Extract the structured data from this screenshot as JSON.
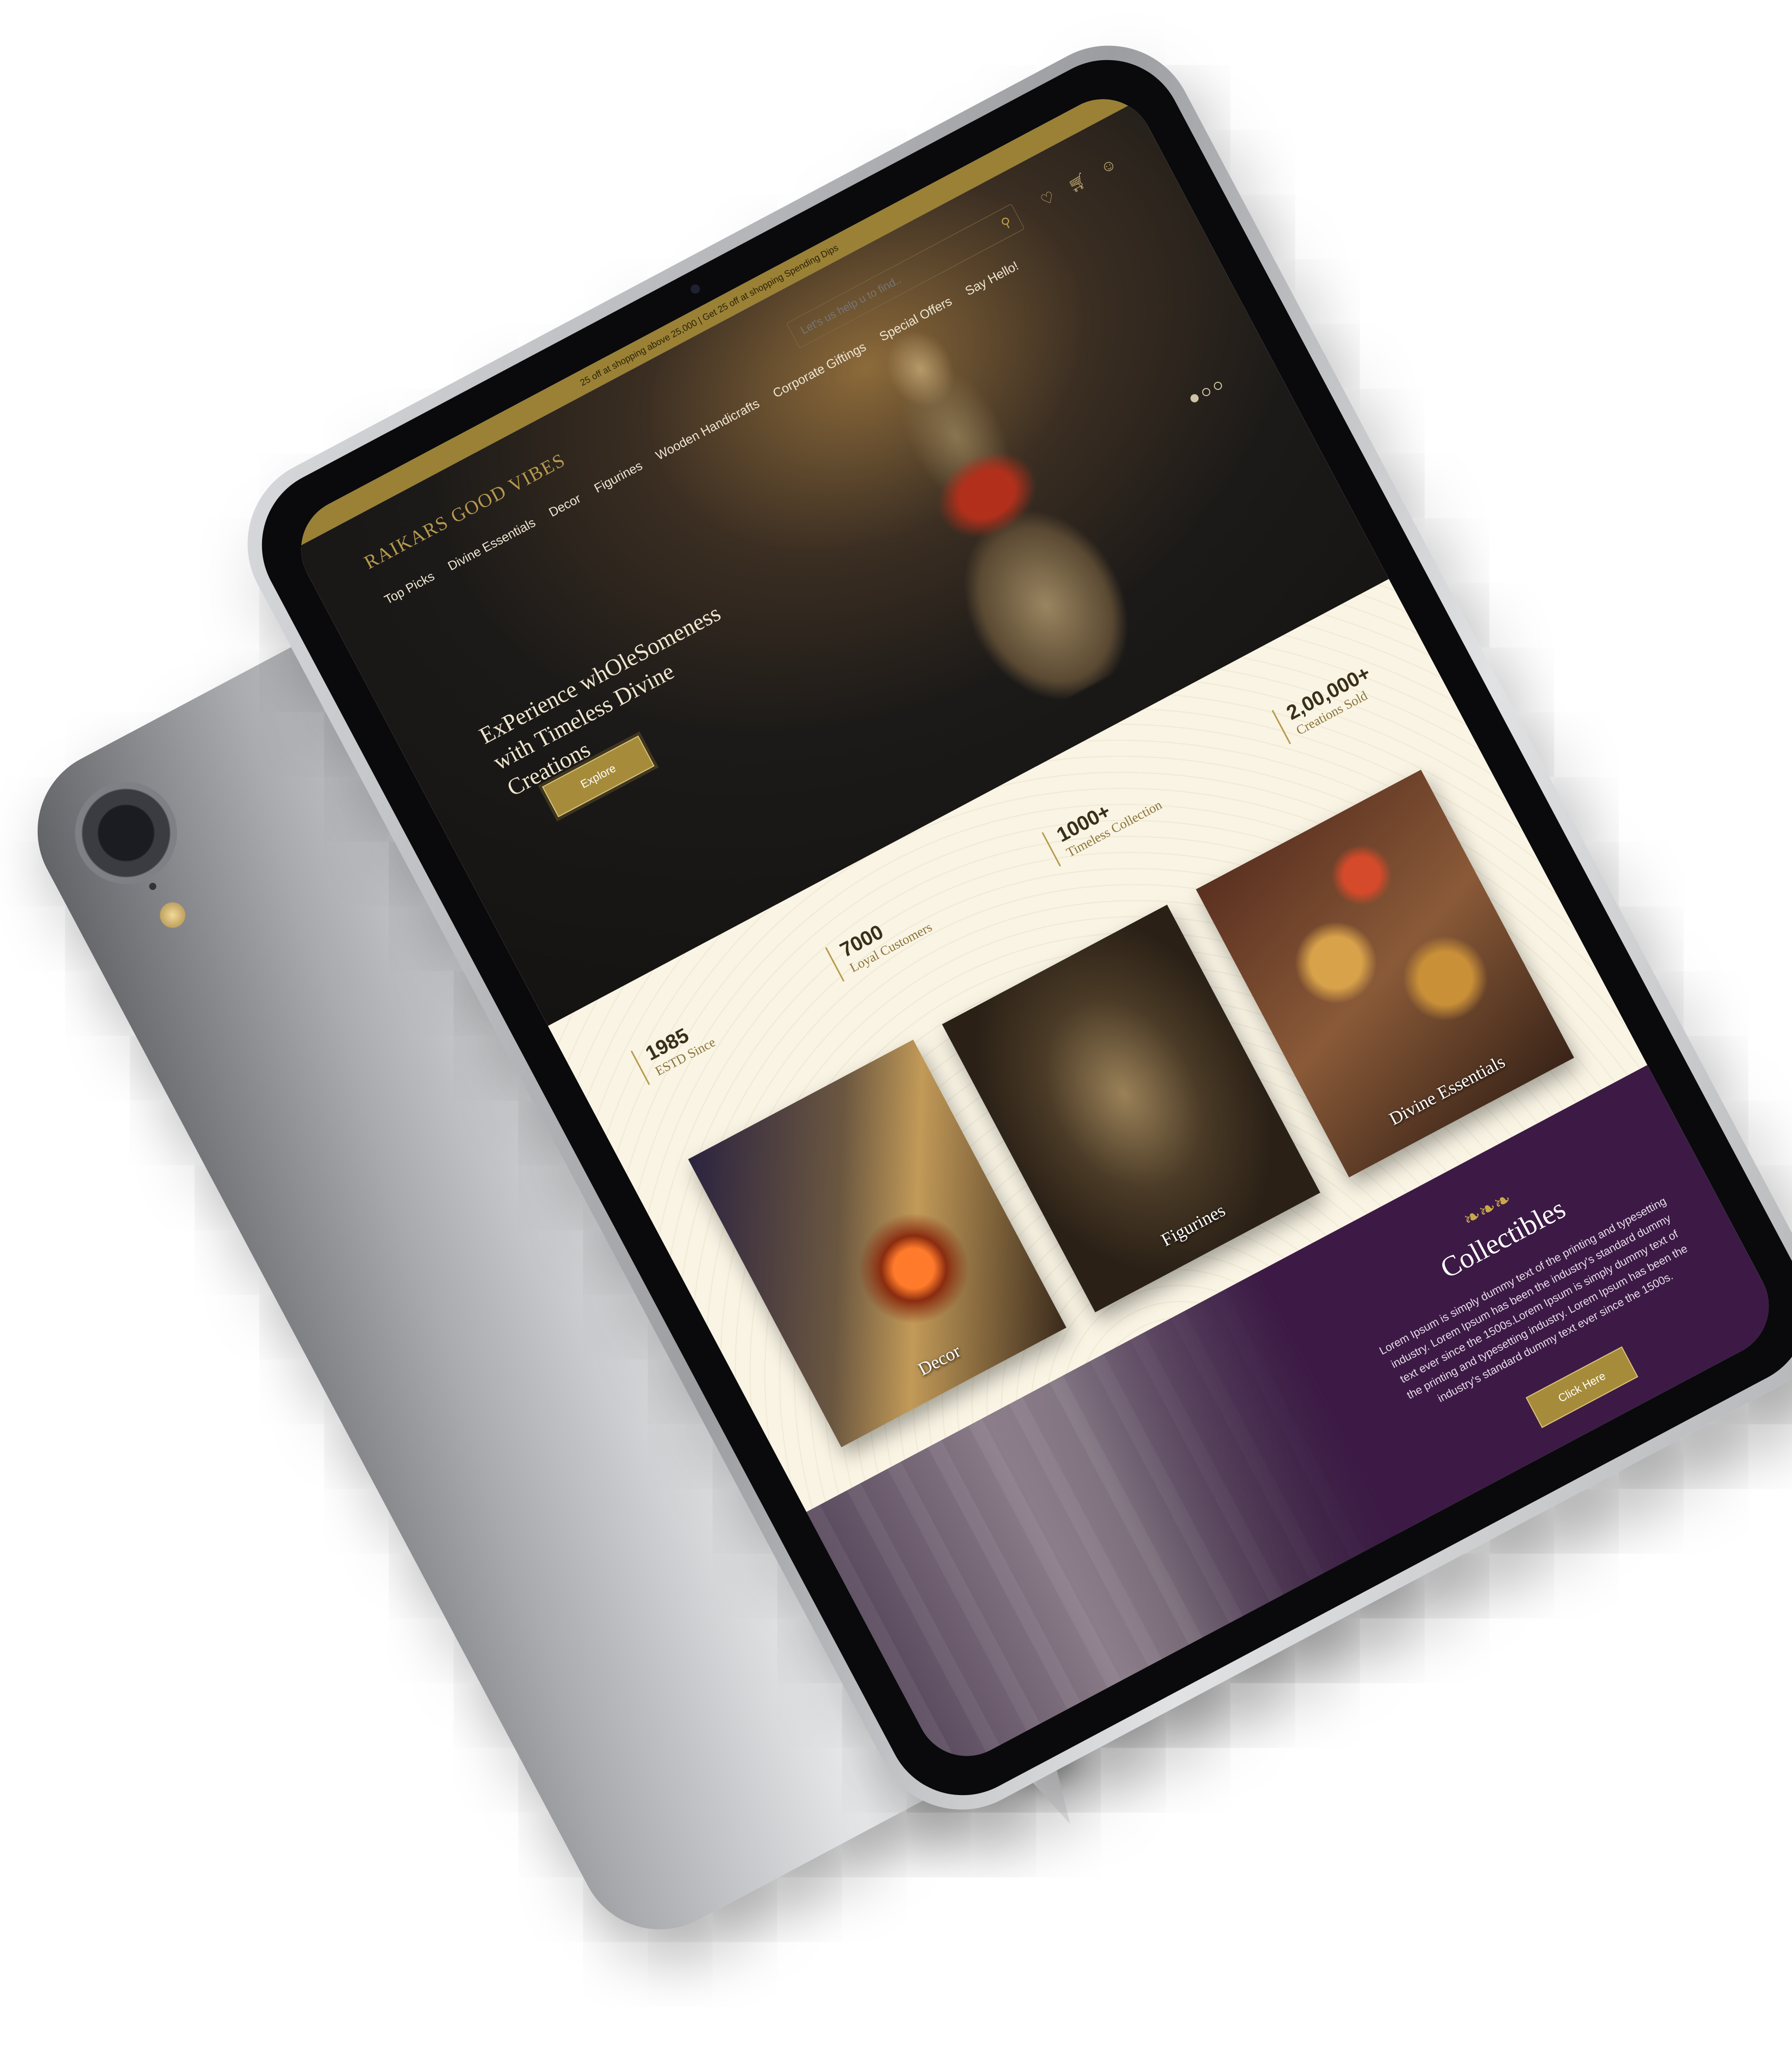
{
  "announcement": "25 off at shopping above 25,000 | Get 25 off at shopping Spending Dips",
  "header": {
    "brand": "RAIKARS GOOD VIBES",
    "search_placeholder": "Let's us help u to find..",
    "icons": [
      "wishlist-icon",
      "cart-icon",
      "user-icon"
    ]
  },
  "nav": [
    "Top Picks",
    "Divine Essentials",
    "Decor",
    "Figurines",
    "Wooden Handicrafts",
    "Corporate Giftings",
    "Special Offers",
    "Say Hello!"
  ],
  "hero": {
    "heading": "ExPerience whOleSomeness with Timeless Divine Creations",
    "button": "Explore",
    "slides": 3,
    "active_slide": 1
  },
  "stats": [
    {
      "num": "1985",
      "label": "ESTD Since"
    },
    {
      "num": "7000",
      "label": "Loyal Customers"
    },
    {
      "num": "1000+",
      "label": "Timeless Collection"
    },
    {
      "num": "2,00,000+",
      "label": "Creations Sold"
    }
  ],
  "categories": [
    "Decor",
    "Figurines",
    "Divine Essentials"
  ],
  "collectibles": {
    "ornament": "ఌ",
    "title": "Collectibles",
    "text": "Lorem Ipsum is simply dummy text of the printing and typesetting industry. Lorem Ipsum has been the industry's standard dummy text ever since the 1500s.Lorem Ipsum is simply dummy text of the printing and typesetting industry. Lorem Ipsum has been the industry's standard dummy text ever since the 1500s.",
    "button": "Click Here"
  },
  "colors": {
    "gold": "#a68b3a",
    "purple": "#3c1a45",
    "cream": "#f9f4e4"
  }
}
